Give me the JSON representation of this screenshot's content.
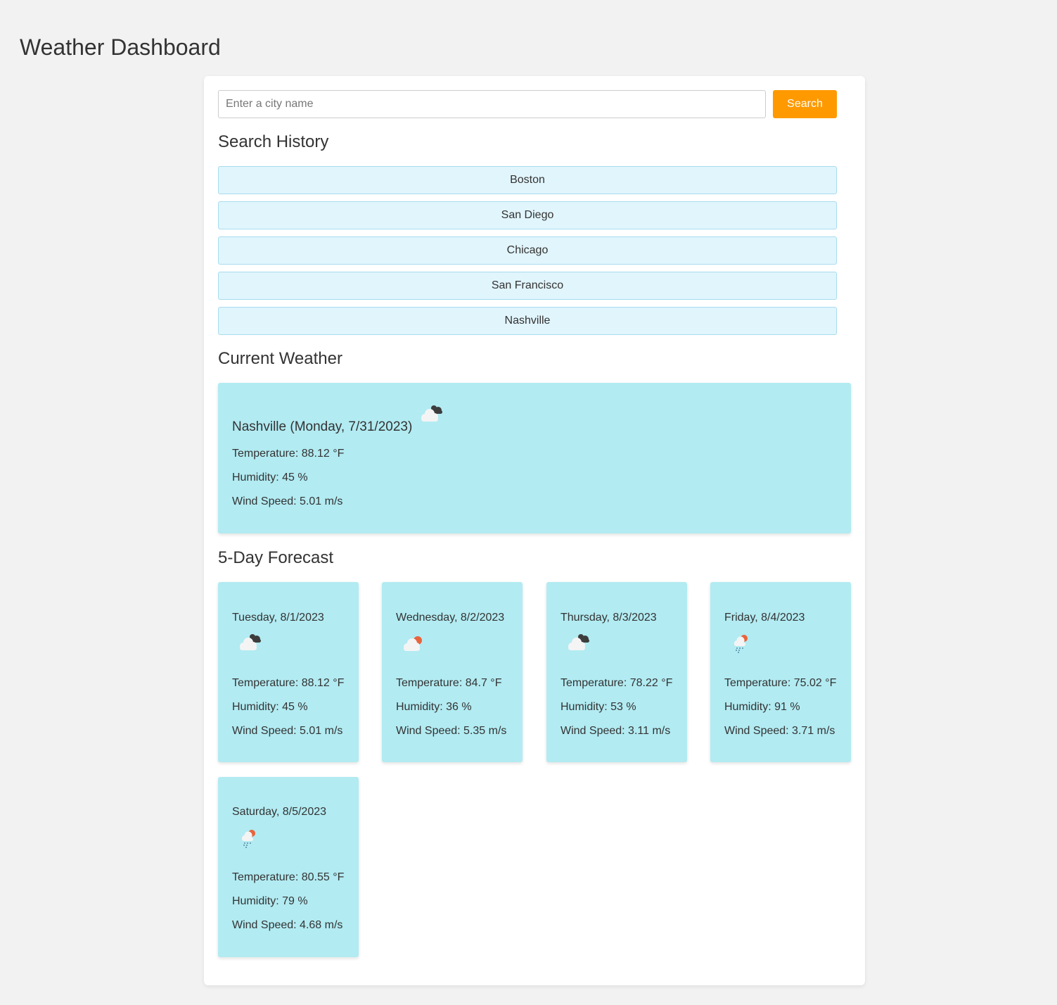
{
  "page": {
    "title": "Weather Dashboard"
  },
  "search": {
    "placeholder": "Enter a city name",
    "value": "",
    "button_label": "Search"
  },
  "history": {
    "heading": "Search History",
    "items": [
      "Boston",
      "San Diego",
      "Chicago",
      "San Francisco",
      "Nashville"
    ]
  },
  "current": {
    "heading": "Current Weather",
    "title": "Nashville (Monday, 7/31/2023)",
    "icon": "broken-clouds-icon",
    "temperature": "Temperature: 88.12 °F",
    "humidity": "Humidity: 45 %",
    "wind": "Wind Speed: 5.01 m/s"
  },
  "forecast": {
    "heading": "5-Day Forecast",
    "days": [
      {
        "date": "Tuesday, 8/1/2023",
        "icon": "broken-clouds-icon",
        "temperature": "Temperature: 88.12 °F",
        "humidity": "Humidity: 45 %",
        "wind": "Wind Speed: 5.01 m/s"
      },
      {
        "date": "Wednesday, 8/2/2023",
        "icon": "few-clouds-icon",
        "temperature": "Temperature: 84.7 °F",
        "humidity": "Humidity: 36 %",
        "wind": "Wind Speed: 5.35 m/s"
      },
      {
        "date": "Thursday, 8/3/2023",
        "icon": "broken-clouds-icon",
        "temperature": "Temperature: 78.22 °F",
        "humidity": "Humidity: 53 %",
        "wind": "Wind Speed: 3.11 m/s"
      },
      {
        "date": "Friday, 8/4/2023",
        "icon": "rain-icon",
        "temperature": "Temperature: 75.02 °F",
        "humidity": "Humidity: 91 %",
        "wind": "Wind Speed: 3.71 m/s"
      },
      {
        "date": "Saturday, 8/5/2023",
        "icon": "rain-icon",
        "temperature": "Temperature: 80.55 °F",
        "humidity": "Humidity: 79 %",
        "wind": "Wind Speed: 4.68 m/s"
      }
    ]
  },
  "colors": {
    "background": "#f2f2f2",
    "panel": "#ffffff",
    "accent_button": "#ff9900",
    "history_item": "#e1f5fc",
    "card": "#b2ebf2",
    "sun": "#e8643c",
    "dark_cloud": "#3d3d3d"
  }
}
